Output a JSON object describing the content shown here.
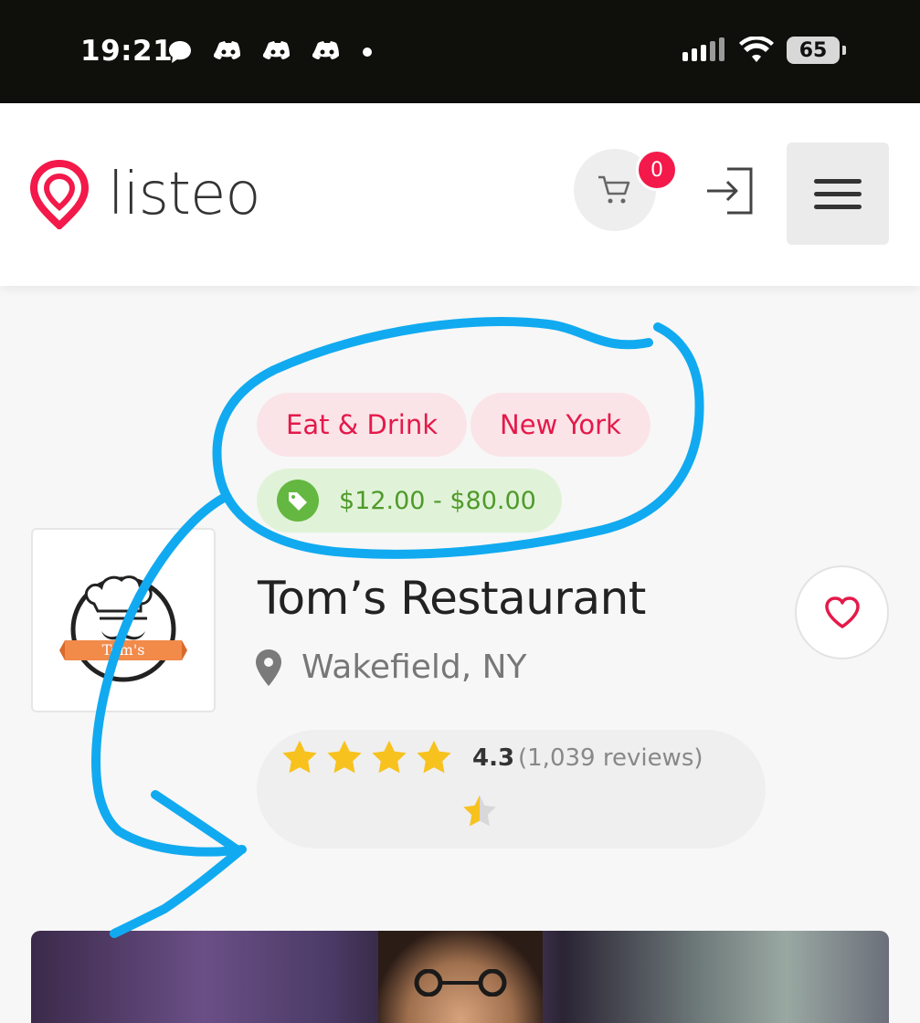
{
  "status_bar": {
    "time": "19:21",
    "battery": "65",
    "icons": [
      "chat-bubble-icon",
      "discord-icon",
      "discord-icon",
      "discord-icon",
      "dot-icon",
      "signal-icon",
      "wifi-icon",
      "battery-icon"
    ]
  },
  "header": {
    "logo_text": "listeo",
    "cart_count": "0",
    "brand_color": "#f3194a"
  },
  "tags": {
    "category": "Eat & Drink",
    "city": "New York",
    "price_range": "$12.00 - $80.00"
  },
  "listing": {
    "title": "Tom’s Restaurant",
    "location": "Wakefield, NY",
    "logo_text": "Tom's",
    "rating": "4.3",
    "reviews": "(1,039 reviews)",
    "rating_fraction": 0.86
  },
  "colors": {
    "accent": "#e4194a",
    "price_green": "#4f9a2a",
    "star": "#f7c21d",
    "annotation_blue": "#11aaf0"
  }
}
